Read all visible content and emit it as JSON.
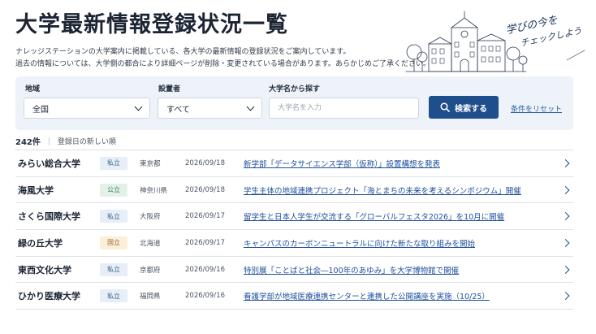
{
  "page": {
    "title": "大学最新情報登録状況一覧",
    "description_1": "ナレッジステーションの大学案内に掲載している、各大学の最新情報の登録状況をご案内しています。",
    "description_2": "過去の情報については、大学側の都合により詳細ページが削除・変更されている場合があります。あらかじめご了承ください。",
    "handwritten_1": "学びの今を",
    "handwritten_2": "チェックしよう"
  },
  "filters": {
    "region_label": "地域",
    "region_value": "全国",
    "type_label": "設置者",
    "type_value": "すべて",
    "name_label": "大学名から探す",
    "name_placeholder": "大学名を入力",
    "name_value": "",
    "search_label": "検索する",
    "reset_label": "条件をリセット"
  },
  "results": {
    "count": "242件",
    "sort": "登録日の新しい順"
  },
  "colors": {
    "accent": "#1e4e8c",
    "link": "#1e4e9c",
    "badge_private_bg": "#e6eef7",
    "badge_private_fg": "#3d5f8a",
    "badge_public_bg": "#e3f1e8",
    "badge_public_fg": "#3f7a57",
    "badge_national_bg": "#fbefd9",
    "badge_national_fg": "#8a6a2e"
  },
  "rows": [
    {
      "university": "みらい総合大学",
      "type": "私立",
      "type_key": "private",
      "prefecture": "東京都",
      "date": "2026/09/18",
      "news": "新学部「データサイエンス学部（仮称）」設置構想を発表"
    },
    {
      "university": "海風大学",
      "type": "公立",
      "type_key": "public",
      "prefecture": "神奈川県",
      "date": "2026/09/18",
      "news": "学生主体の地域連携プロジェクト「海とまちの未来を考えるシンポジウム」開催"
    },
    {
      "university": "さくら国際大学",
      "type": "私立",
      "type_key": "private",
      "prefecture": "大阪府",
      "date": "2026/09/17",
      "news": "留学生と日本人学生が交流する「グローバルフェスタ2026」を10月に開催"
    },
    {
      "university": "緑の丘大学",
      "type": "国立",
      "type_key": "national",
      "prefecture": "北海道",
      "date": "2026/09/17",
      "news": "キャンパスのカーボンニュートラルに向けた新たな取り組みを開始"
    },
    {
      "university": "東西文化大学",
      "type": "私立",
      "type_key": "private",
      "prefecture": "京都府",
      "date": "2026/09/16",
      "news": "特別展「ことばと社会―100年のあゆみ」を大学博物館で開催"
    },
    {
      "university": "ひかり医療大学",
      "type": "私立",
      "type_key": "private",
      "prefecture": "福岡県",
      "date": "2026/09/16",
      "news": "看護学部が地域医療連携センターと連携した公開講座を実施（10/25）"
    }
  ]
}
